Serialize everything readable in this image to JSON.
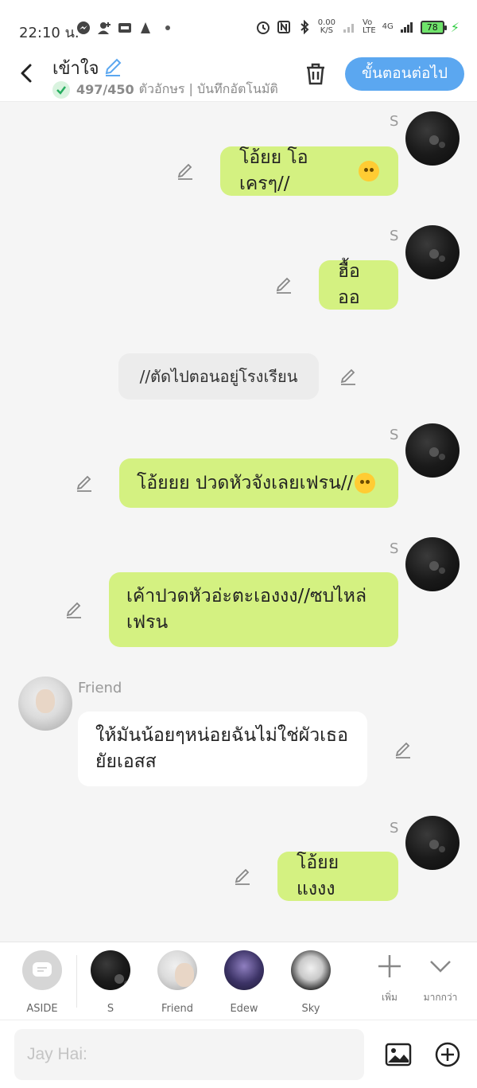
{
  "status_bar": {
    "time": "22:10 น.",
    "net_speed_value": "0.00",
    "net_speed_unit": "K/S",
    "network_label_1": "Vo",
    "network_label_2": "LTE",
    "network_label_3": "4G",
    "battery": "78"
  },
  "header": {
    "title": "เข้าใจ",
    "char_count": "497/450",
    "subtitle_text": "ตัวอักษร | บันทึกอัตโนมัติ",
    "next_button": "ขั้นตอนต่อไป"
  },
  "messages": [
    {
      "speaker": "S",
      "text": "โอ้ยย โอเครๆ//",
      "emoji": "crying-smile"
    },
    {
      "speaker": "S",
      "text": "ฮื้อออ"
    },
    {
      "type": "aside",
      "text": "//ตัดไปตอนอยู่โรงเรียน"
    },
    {
      "speaker": "S",
      "text": "โอ้ยยย ปวดหัวจังเลยเฟรน//",
      "emoji": "dizzy"
    },
    {
      "speaker": "S",
      "line1": "เค้าปวดหัวอ่ะตะเองงง//ซบไหล่",
      "line2": "เฟรน"
    },
    {
      "speaker": "Friend",
      "line1": "ให้มันน้อยๆหน่อยฉันไม่ใช่ผัวเธอ",
      "line2": "ยัยเอสส"
    },
    {
      "speaker": "S",
      "text": "โอ้ยย แงงง"
    }
  ],
  "characters": [
    {
      "name": "ASIDE"
    },
    {
      "name": "S"
    },
    {
      "name": "Friend"
    },
    {
      "name": "Edew"
    },
    {
      "name": "Sky"
    }
  ],
  "tools": {
    "add_label": "เพิ่ม",
    "more_label": "มากกว่า"
  },
  "input": {
    "placeholder": "Jay Hai:"
  },
  "colors": {
    "accent": "#5ba7f0",
    "bubble_green": "#d4f181",
    "background": "#f5f5f5"
  }
}
